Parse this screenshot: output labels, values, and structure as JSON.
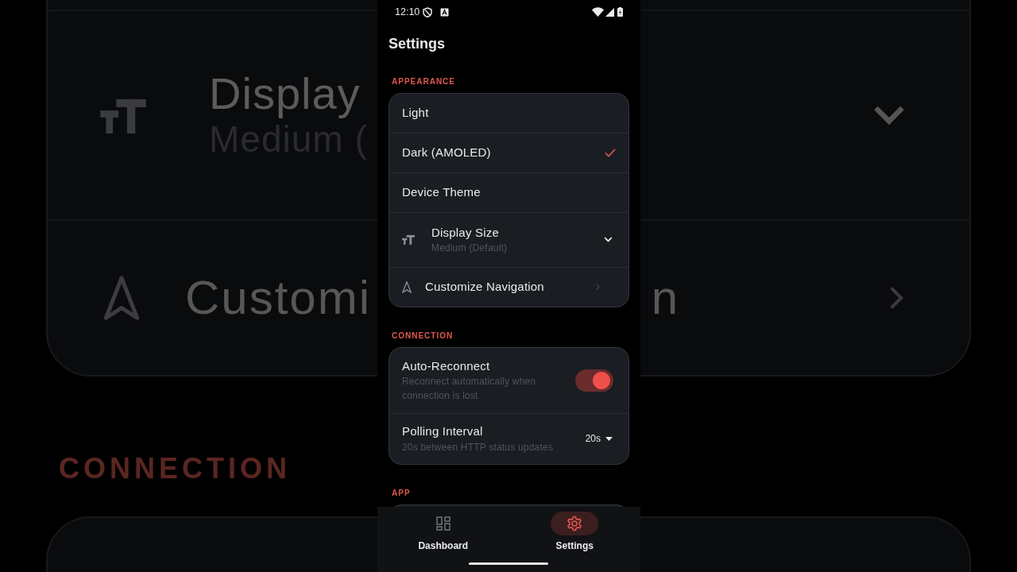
{
  "backdrop": {
    "rows": [
      {
        "kind": "dropdown",
        "title": "Display",
        "subtitle": "Medium ("
      },
      {
        "kind": "link",
        "title": "Customi",
        "tail": "n"
      }
    ],
    "section_label": "CONNECTION"
  },
  "status_bar": {
    "time": "12:10"
  },
  "title": "Settings",
  "sections": [
    {
      "label": "APPEARANCE",
      "items": [
        {
          "kind": "option",
          "label": "Light",
          "selected": false
        },
        {
          "kind": "option",
          "label": "Dark (AMOLED)",
          "selected": true
        },
        {
          "kind": "option",
          "label": "Device Theme",
          "selected": false
        },
        {
          "kind": "dropdown",
          "label": "Display Size",
          "value": "Medium (Default)"
        },
        {
          "kind": "link",
          "label": "Customize Navigation"
        }
      ]
    },
    {
      "label": "CONNECTION",
      "items": [
        {
          "kind": "toggle",
          "label": "Auto-Reconnect",
          "description": "Reconnect automatically when connection is lost",
          "on": true
        },
        {
          "kind": "select",
          "label": "Polling Interval",
          "description": "20s between HTTP status updates",
          "value": "20s"
        }
      ]
    },
    {
      "label": "APP"
    }
  ],
  "nav": [
    {
      "label": "Dashboard",
      "selected": false
    },
    {
      "label": "Settings",
      "selected": true
    }
  ]
}
